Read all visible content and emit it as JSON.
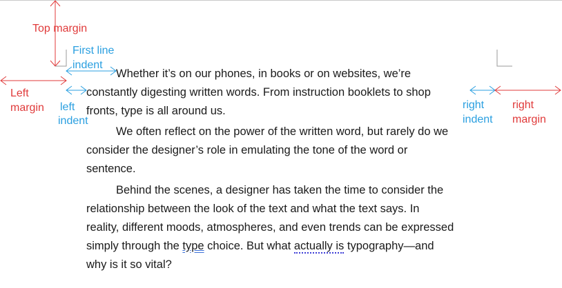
{
  "labels": {
    "top_margin": "Top margin",
    "first_line_indent_1": "First line",
    "first_line_indent_2": "indent",
    "left_margin_1": "Left",
    "left_margin_2": "margin",
    "left_indent_1": "left",
    "left_indent_2": "indent",
    "right_indent_1": "right",
    "right_indent_2": "indent",
    "right_margin_1": "right",
    "right_margin_2": "margin"
  },
  "paragraphs": [
    {
      "lines": [
        "Whether it’s on our phones, in books or on websites, we’re",
        "constantly digesting written words. From instruction booklets to shop",
        "fronts, type is all around us."
      ]
    },
    {
      "lines": [
        "We often reflect on the power of the written word, but rarely do we",
        "consider the designer’s role in emulating the tone of the word or",
        "sentence."
      ]
    },
    {
      "p3_l1": "Behind the scenes, a designer has taken the time to consider the",
      "p3_l2": "relationship between the look of the text and what the text says. In",
      "p3_l3": "reality, different moods, atmospheres, and even trends can be expressed",
      "p3_l4_a": "simply through the ",
      "p3_l4_b": "type",
      "p3_l4_c": " choice. But what ",
      "p3_l4_d": "actually is",
      "p3_l4_e": " typography—and",
      "p3_l5": "why is it so vital?"
    }
  ],
  "colors": {
    "margin": "#e03a3a",
    "indent": "#2a9fe0"
  }
}
